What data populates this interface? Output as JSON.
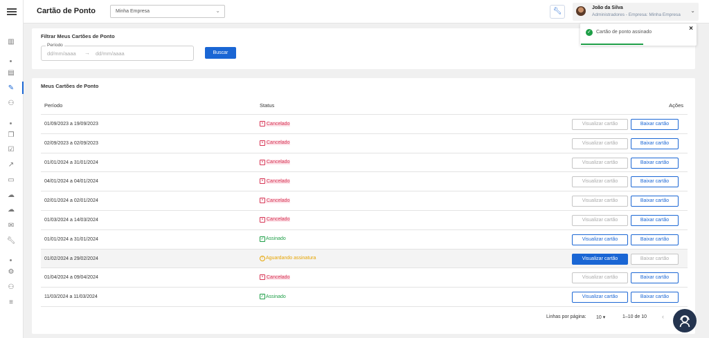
{
  "header": {
    "title": "Cartão de Ponto",
    "company_select": "Minha Empresa",
    "user_name": "João da Silva",
    "user_role": "Administradores - Empresa: Minha Empresa"
  },
  "filter": {
    "title": "Filtrar Meus Cartões de Ponto",
    "period_label": "Período",
    "start_placeholder": "dd/mm/aaaa",
    "arrow": "→",
    "end_placeholder": "dd/mm/aaaa",
    "search_label": "Buscar"
  },
  "list": {
    "title": "Meus Cartões de Ponto",
    "columns": {
      "period": "Período",
      "status": "Status",
      "actions": "Ações"
    },
    "view_label": "Visualizar cartão",
    "download_label": "Baixar cartão",
    "rows": [
      {
        "period": "01/09/2023 a 19/09/2023",
        "status": "Cancelado"
      },
      {
        "period": "02/09/2023 a 02/09/2023",
        "status": "Cancelado"
      },
      {
        "period": "01/01/2024 a 31/01/2024",
        "status": "Cancelado"
      },
      {
        "period": "04/01/2024 a 04/01/2024",
        "status": "Cancelado"
      },
      {
        "period": "02/01/2024 a 02/01/2024",
        "status": "Cancelado"
      },
      {
        "period": "01/03/2024 a 14/03/2024",
        "status": "Cancelado"
      },
      {
        "period": "01/01/2024 a 31/01/2024",
        "status": "Assinado"
      },
      {
        "period": "01/02/2024 a 29/02/2024",
        "status": "Aguardando assinatura"
      },
      {
        "period": "01/04/2024 a 09/04/2024",
        "status": "Cancelado"
      },
      {
        "period": "11/03/2024 a 11/03/2024",
        "status": "Assinado"
      }
    ],
    "pagination": {
      "rows_label": "Linhas por página:",
      "rows_per_page": "10",
      "range": "1–10 de 10"
    }
  },
  "toast": {
    "message": "Cartão de ponto assinado"
  },
  "colors": {
    "primary": "#1a66d4",
    "cancel": "#d63353",
    "signed": "#1d9e46",
    "pending": "#e6a400"
  }
}
